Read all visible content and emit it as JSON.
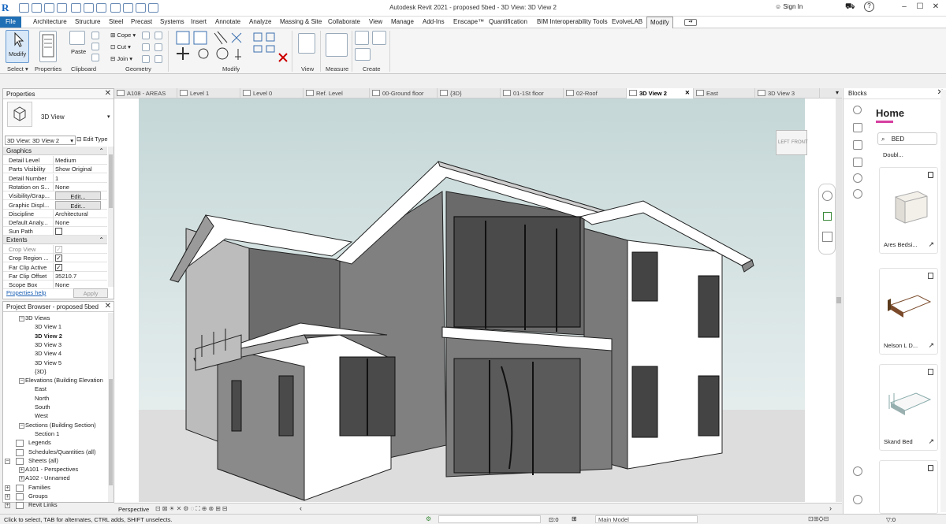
{
  "window": {
    "title": "Autodesk Revit 2021 - proposed 5bed - 3D View: 3D View 2",
    "sign_in": "Sign In"
  },
  "menu": {
    "tabs": [
      "File",
      "Architecture",
      "Structure",
      "Steel",
      "Precast",
      "Systems",
      "Insert",
      "Annotate",
      "Analyze",
      "Massing & Site",
      "Collaborate",
      "View",
      "Manage",
      "Add-Ins",
      "Enscape™",
      "Quantification",
      "BIM Interoperability Tools",
      "EvolveLAB",
      "Modify"
    ],
    "active": "Modify"
  },
  "ribbon": {
    "modify_label": "Modify",
    "paste_label": "Paste",
    "cope_label": "Cope",
    "cut_label": "Cut",
    "join_label": "Join",
    "panels": {
      "select": "Select",
      "properties": "Properties",
      "clipboard": "Clipboard",
      "geometry": "Geometry",
      "modify": "Modify",
      "view": "View",
      "measure": "Measure",
      "create": "Create"
    }
  },
  "properties": {
    "title": "Properties",
    "type_name": "3D View",
    "selector": "3D View: 3D View 2",
    "edit_type": "Edit Type",
    "groups": {
      "graphics": "Graphics",
      "extents": "Extents"
    },
    "rows": [
      {
        "k": "Detail Level",
        "v": "Medium"
      },
      {
        "k": "Parts Visibility",
        "v": "Show Original"
      },
      {
        "k": "Detail Number",
        "v": "1"
      },
      {
        "k": "Rotation on S...",
        "v": "None"
      },
      {
        "k": "Visibility/Grap...",
        "v": "Edit..."
      },
      {
        "k": "Graphic Displ...",
        "v": "Edit..."
      },
      {
        "k": "Discipline",
        "v": "Architectural"
      },
      {
        "k": "Default Analy...",
        "v": "None"
      },
      {
        "k": "Sun Path",
        "v": ""
      }
    ],
    "extents_rows": [
      {
        "k": "Crop View",
        "v": ""
      },
      {
        "k": "Crop Region ...",
        "v": ""
      },
      {
        "k": "Far Clip Active",
        "v": ""
      },
      {
        "k": "Far Clip Offset",
        "v": "35210.7"
      },
      {
        "k": "Scope Box",
        "v": "None"
      }
    ],
    "help": "Properties help",
    "apply": "Apply"
  },
  "browser": {
    "title": "Project Browser - proposed 5bed",
    "items": [
      "3D Views",
      "3D View 1",
      "3D View 2",
      "3D View 3",
      "3D View 4",
      "3D View 5",
      "{3D}",
      "Elevations (Building Elevation",
      "East",
      "North",
      "South",
      "West",
      "Sections (Building Section)",
      "Section 1",
      "Legends",
      "Schedules/Quantities (all)",
      "Sheets (all)",
      "A101 - Perspectives",
      "A102 - Unnamed",
      "Families",
      "Groups",
      "Revit Links"
    ]
  },
  "doc_tabs": [
    "A108 - AREAS",
    "Level 1",
    "Level 0",
    "Ref. Level",
    "00-Ground floor",
    "{3D}",
    "01-1St floor",
    "02-Roof",
    "3D View 2",
    "East",
    "3D View 3"
  ],
  "viewcube": {
    "left": "LEFT",
    "front": "FRONT"
  },
  "view_bar": {
    "mode": "Perspective"
  },
  "status": {
    "hint": "Click to select, TAB for alternates, CTRL adds, SHIFT unselects.",
    "counter": ":0",
    "model": "Main Model",
    "filter": ":0"
  },
  "blocks": {
    "title": "Blocks",
    "home": "Home",
    "search_value": "BED",
    "cards": [
      {
        "name": "Doubl..."
      },
      {
        "name": "Ares Bedsi..."
      },
      {
        "name": "Nelson L D..."
      },
      {
        "name": "Skand Bed"
      }
    ]
  },
  "colors": {
    "accent": "#1f6fb5",
    "ribbon": "#f5f5f5",
    "sky": "#cbdadc",
    "ground": "#dcdcdc",
    "brand_underline": "#e040a0"
  }
}
